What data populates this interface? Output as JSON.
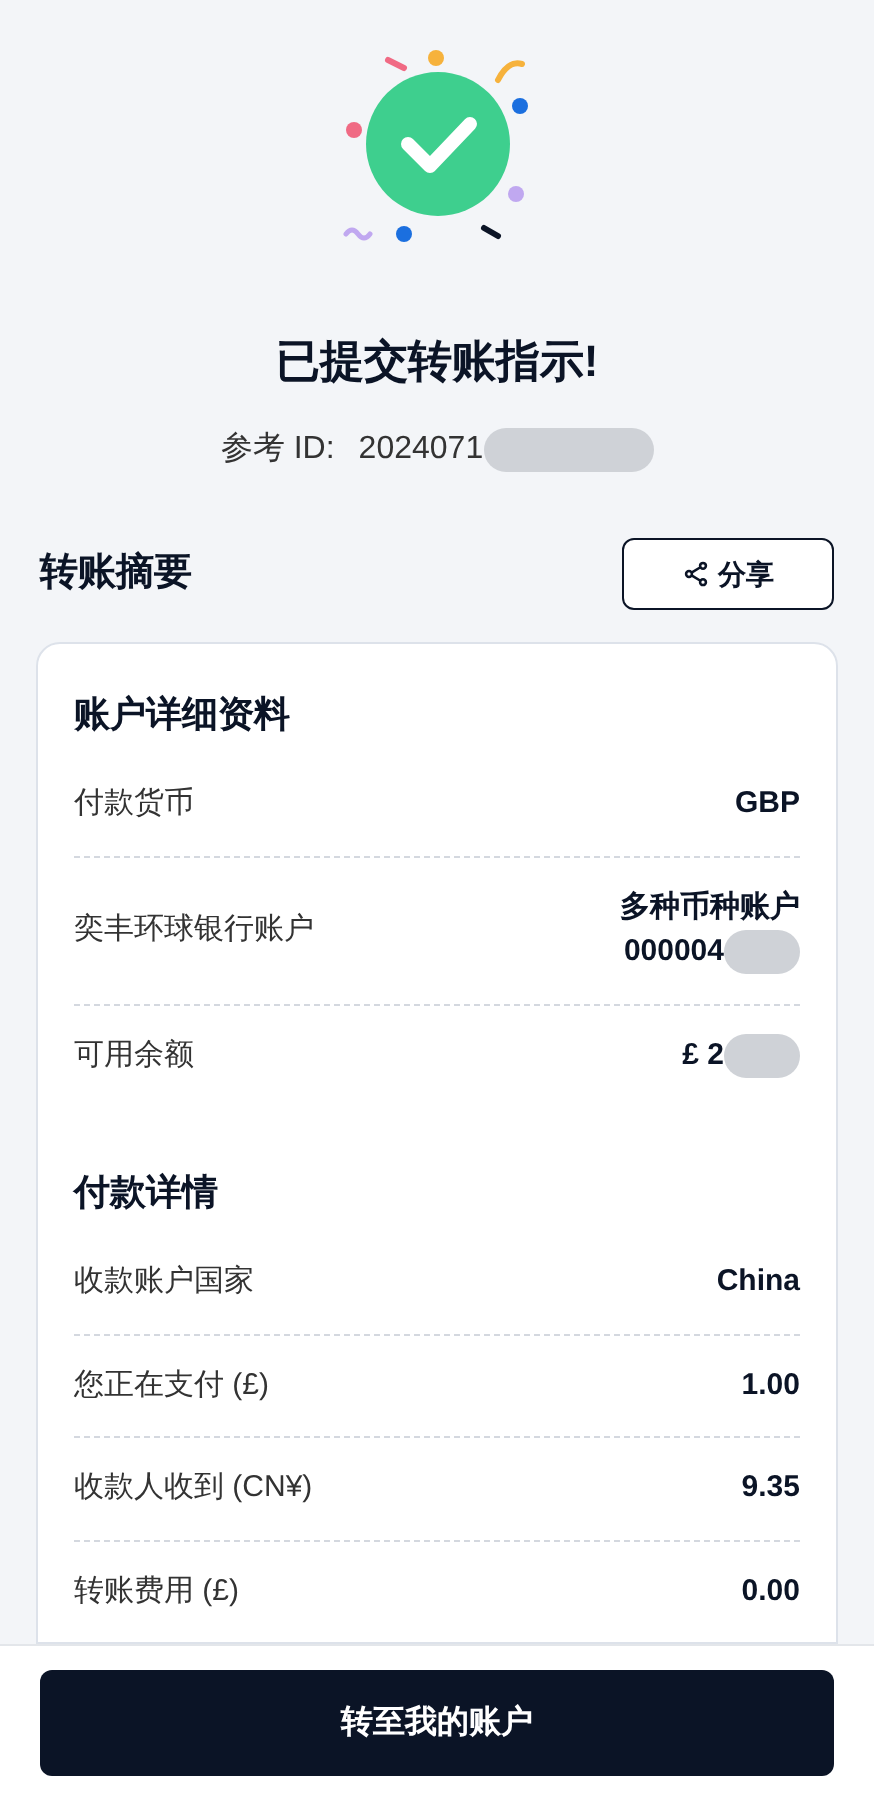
{
  "title": "已提交转账指示!",
  "reference": {
    "label": "参考 ID:",
    "value": "2024071",
    "redacted": true
  },
  "summary": {
    "heading": "转账摘要",
    "share_button": "分享"
  },
  "sections": [
    {
      "heading": "账户详细资料",
      "rows": [
        {
          "label": "付款货币",
          "value": [
            "GBP"
          ],
          "redacted": false
        },
        {
          "label": "奕丰环球银行账户",
          "value": [
            "多种币种账户",
            "000004"
          ],
          "redacted": true
        },
        {
          "label": "可用余额",
          "value": [
            "£ 2"
          ],
          "redacted": true
        }
      ]
    },
    {
      "heading": "付款详情",
      "rows": [
        {
          "label": "收款账户国家",
          "value": [
            "China"
          ],
          "redacted": false
        },
        {
          "label": "您正在支付 (£)",
          "value": [
            "1.00"
          ],
          "redacted": false
        },
        {
          "label": "收款人收到 (CN¥)",
          "value": [
            "9.35"
          ],
          "redacted": false
        },
        {
          "label": "转账费用 (£)",
          "value": [
            "0.00"
          ],
          "redacted": false
        }
      ]
    }
  ],
  "footer_button": "转至我的账户"
}
